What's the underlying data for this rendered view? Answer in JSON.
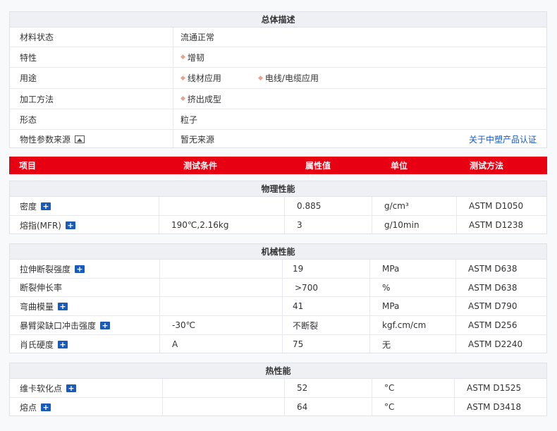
{
  "general": {
    "title": "总体描述",
    "rows": [
      {
        "label": "材料状态",
        "values": [
          "流通正常"
        ],
        "bullet": false
      },
      {
        "label": "特性",
        "values": [
          "增韧"
        ],
        "bullet": true
      },
      {
        "label": "用途",
        "values": [
          "线材应用",
          "电线/电缆应用"
        ],
        "bullet": true
      },
      {
        "label": "加工方法",
        "values": [
          "挤出成型"
        ],
        "bullet": true
      },
      {
        "label": "形态",
        "values": [
          "粒子"
        ],
        "bullet": false
      },
      {
        "label": "物性参数来源",
        "values": [
          "暂无来源"
        ],
        "bullet": false,
        "link": "关于中塑产品认证"
      }
    ]
  },
  "header": {
    "item": "项目",
    "condition": "测试条件",
    "value": "属性值",
    "unit": "单位",
    "method": "测试方法"
  },
  "physical": {
    "title": "物理性能",
    "rows": [
      {
        "item": "密度",
        "condition": "",
        "value": "0.885",
        "unit": "g/cm³",
        "method": "ASTM D1050"
      },
      {
        "item": "熔指(MFR)",
        "condition": "190℃,2.16kg",
        "value": "3",
        "unit": "g/10min",
        "method": "ASTM D1238"
      }
    ]
  },
  "mechanical": {
    "title": "机械性能",
    "rows": [
      {
        "item": "拉伸断裂强度",
        "condition": "",
        "value": "19",
        "unit": "MPa",
        "method": "ASTM D638",
        "plus": true
      },
      {
        "item": "断裂伸长率",
        "condition": "",
        "value": ">700",
        "unit": "%",
        "method": "ASTM D638",
        "plus": false
      },
      {
        "item": "弯曲模量",
        "condition": "",
        "value": "41",
        "unit": "MPa",
        "method": "ASTM D790",
        "plus": true
      },
      {
        "item": "暴臂梁缺口冲击强度",
        "condition": "-30℃",
        "value": "不断裂",
        "unit": "kgf.cm/cm",
        "method": "ASTM D256",
        "plus": true
      },
      {
        "item": "肖氏硬度",
        "condition": "A",
        "value": "75",
        "unit": "无",
        "method": "ASTM D2240",
        "plus": true
      }
    ]
  },
  "thermal": {
    "title": "热性能",
    "rows": [
      {
        "item": "维卡软化点",
        "condition": "",
        "value": "52",
        "unit": "°C",
        "method": "ASTM D1525",
        "plus": true
      },
      {
        "item": "熔点",
        "condition": "",
        "value": "64",
        "unit": "°C",
        "method": "ASTM D3418",
        "plus": true
      }
    ]
  }
}
